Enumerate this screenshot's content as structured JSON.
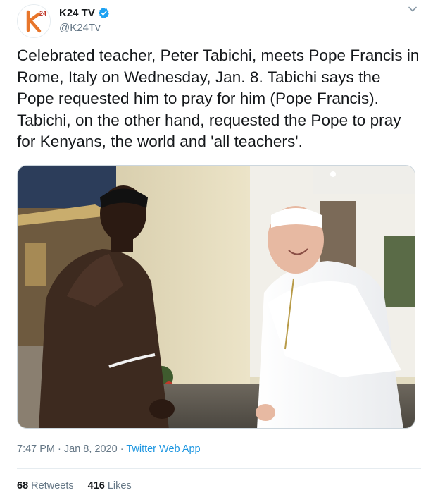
{
  "author": {
    "display_name": "K24 TV",
    "handle": "@K24Tv",
    "verified": true,
    "avatar_icon": "k24-logo-icon"
  },
  "tweet": {
    "text": "Celebrated teacher, Peter Tabichi, meets Pope Francis in Rome, Italy on Wednesday, Jan. 8. Tabichi says the Pope requested him to pray for him (Pope Francis). Tabichi, on the other hand, requested the Pope to pray for Kenyans, the world and 'all teachers'."
  },
  "media": {
    "icon": "photo-of-teacher-meeting-pope"
  },
  "meta": {
    "time": "7:47 PM",
    "date": "Jan 8, 2020",
    "separator": " · ",
    "source": "Twitter Web App"
  },
  "stats": {
    "retweets_count": "68",
    "retweets_label": "Retweets",
    "likes_count": "416",
    "likes_label": "Likes"
  },
  "colors": {
    "accent": "#1b95e0",
    "verified": "#1da1f2",
    "secondary_text": "#657786",
    "k24_orange": "#e8762b"
  }
}
